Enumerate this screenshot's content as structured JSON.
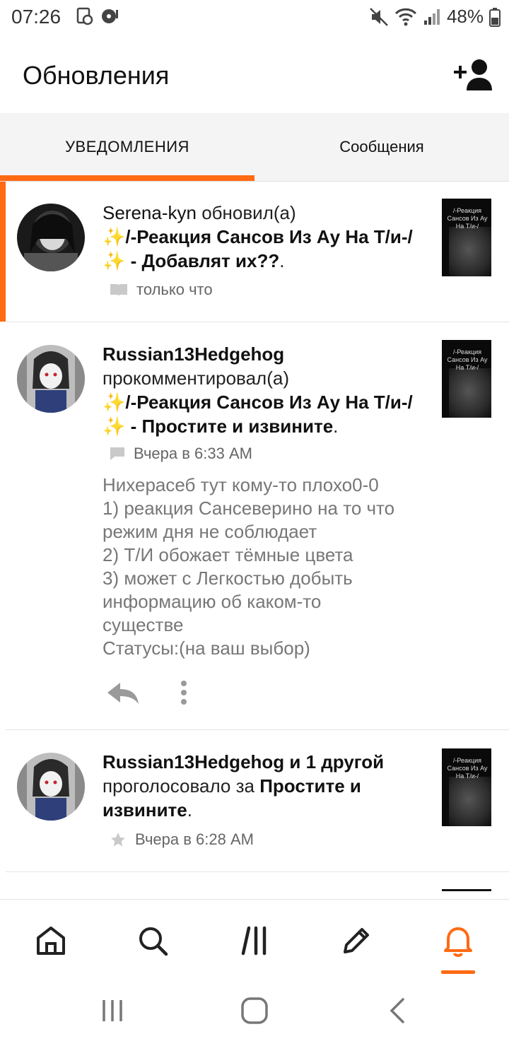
{
  "status_bar": {
    "time": "07:26",
    "battery": "48%"
  },
  "header": {
    "title": "Обновления",
    "add_user_icon": "person-add-icon"
  },
  "tabs": [
    {
      "label": "УВЕДОМЛЕНИЯ",
      "active": true
    },
    {
      "label": "Сообщения",
      "active": false
    }
  ],
  "notifications": [
    {
      "user": "Serena-kyn",
      "action": "обновил(а)",
      "story_title": "✨/-Реакция Сансов Из Ау На Т/и-/✨",
      "separator": " - ",
      "target": "Добавлят их??",
      "period": ".",
      "meta_icon": "book-icon",
      "time": "только что",
      "thumb_text": "/-Реакция Сансов Из Ау На Т/и-/"
    },
    {
      "user": "Russian13Hedgehog",
      "action": "прокомментировал(а)",
      "story_title": "✨/-Реакция Сансов Из Ау На Т/и-/✨",
      "separator": " - ",
      "target": "Простите и извините",
      "period": ".",
      "meta_icon": "comment-icon",
      "time": "Вчера в 6:33 AM",
      "thumb_text": "/-Реакция Сансов Из Ау На Т/и-/",
      "comment_lines": [
        "Нихерасеб тут кому-то плохо0-0",
        "1) реакция Сансеверино на то что",
        "режим дня не соблюдает",
        "2) Т/И обожает тёмные цвета",
        "3) может с Легкостью добыть",
        "информацию об каком-то",
        "существе",
        "Статусы:(на ваш выбор)"
      ]
    },
    {
      "user": "Russian13Hedgehog",
      "user_suffix": " и 1 другой",
      "action": "проголосовало за",
      "target": "Простите и извините",
      "period": ".",
      "meta_icon": "star-icon",
      "time": "Вчера в 6:28 AM",
      "thumb_text": "/-Реакция Сансов Из Ау На Т/и-/"
    }
  ],
  "bottom_nav": [
    "home-icon",
    "search-icon",
    "library-icon",
    "write-icon",
    "notifications-icon"
  ],
  "colors": {
    "accent": "#ff6a13"
  }
}
